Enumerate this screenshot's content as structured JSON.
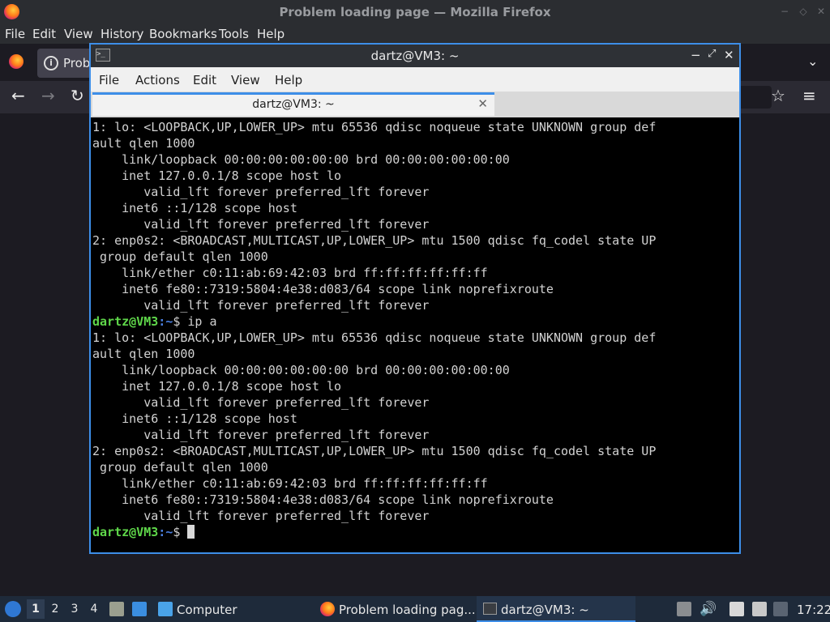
{
  "firefox": {
    "title": "Problem loading page — Mozilla Firefox",
    "menu": [
      "File",
      "Edit",
      "View",
      "History",
      "Bookmarks",
      "Tools",
      "Help"
    ],
    "tab_label": "Probl",
    "nav": {
      "back": "←",
      "forward": "→",
      "reload": "↻",
      "bookmark": "☆",
      "menu": "≡",
      "tabs_dropdown": "⌄"
    }
  },
  "terminal": {
    "title": "dartz@VM3: ~",
    "menu": [
      "File",
      "Actions",
      "Edit",
      "View",
      "Help"
    ],
    "tab_label": "dartz@VM3: ~",
    "tab_close": "✕",
    "prompt_user": "dartz@VM3",
    "prompt_path": ":~",
    "prompt_symbol": "$",
    "command": "ip a",
    "block1": "1: lo: <LOOPBACK,UP,LOWER_UP> mtu 65536 qdisc noqueue state UNKNOWN group def\nault qlen 1000\n    link/loopback 00:00:00:00:00:00 brd 00:00:00:00:00:00\n    inet 127.0.0.1/8 scope host lo\n       valid_lft forever preferred_lft forever\n    inet6 ::1/128 scope host\n       valid_lft forever preferred_lft forever\n2: enp0s2: <BROADCAST,MULTICAST,UP,LOWER_UP> mtu 1500 qdisc fq_codel state UP\n group default qlen 1000\n    link/ether c0:11:ab:69:42:03 brd ff:ff:ff:ff:ff:ff\n    inet6 fe80::7319:5804:4e38:d083/64 scope link noprefixroute\n       valid_lft forever preferred_lft forever",
    "block2": "1: lo: <LOOPBACK,UP,LOWER_UP> mtu 65536 qdisc noqueue state UNKNOWN group def\nault qlen 1000\n    link/loopback 00:00:00:00:00:00 brd 00:00:00:00:00:00\n    inet 127.0.0.1/8 scope host lo\n       valid_lft forever preferred_lft forever\n    inet6 ::1/128 scope host\n       valid_lft forever preferred_lft forever\n2: enp0s2: <BROADCAST,MULTICAST,UP,LOWER_UP> mtu 1500 qdisc fq_codel state UP\n group default qlen 1000\n    link/ether c0:11:ab:69:42:03 brd ff:ff:ff:ff:ff:ff\n    inet6 fe80::7319:5804:4e38:d083/64 scope link noprefixroute\n       valid_lft forever preferred_lft forever"
  },
  "taskbar": {
    "workspaces": [
      "1",
      "2",
      "3",
      "4"
    ],
    "file_manager_label": "Computer",
    "tasks": [
      "Problem loading pag...",
      "dartz@VM3: ~"
    ],
    "clock": "17:22"
  },
  "colors": {
    "accent": "#3d8ee8",
    "prompt_user": "#5fd74a",
    "prompt_path": "#4a7fe0",
    "terminal_bg": "#000000",
    "taskbar_bg": "#1e2a3a"
  }
}
